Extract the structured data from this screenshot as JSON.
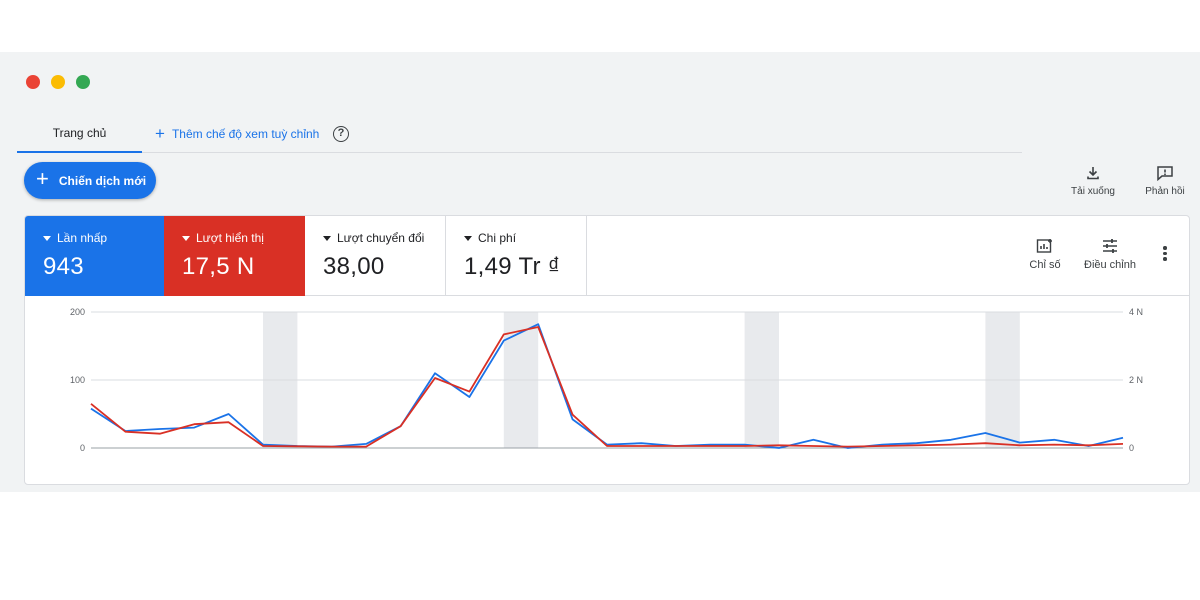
{
  "tabs": {
    "home": "Trang chủ",
    "add_view": "Thêm chế độ xem tuỳ chỉnh",
    "help": "?"
  },
  "new_campaign": "Chiến dịch mới",
  "utilities": {
    "download": "Tải xuống",
    "feedback": "Phản hồi"
  },
  "metrics": [
    {
      "label": "Lần nhấp",
      "value": "943",
      "color": "#1a73e8"
    },
    {
      "label": "Lượt hiển thị",
      "value": "17,5 N",
      "color": "#d93025"
    },
    {
      "label": "Lượt chuyển đổi",
      "value": "38,00"
    },
    {
      "label": "Chi phí",
      "value": "1,49 Tr ₫"
    }
  ],
  "tools": {
    "metrics": "Chỉ số",
    "adjust": "Điều chỉnh"
  },
  "colors": {
    "clicks": "#1a73e8",
    "impressions": "#d93025",
    "weekend_band": "#e8eaed"
  },
  "chart_data": {
    "type": "line",
    "left_axis": {
      "ticks": [
        "200",
        "100",
        "0"
      ],
      "range": [
        0,
        200
      ]
    },
    "right_axis": {
      "ticks": [
        "4 N",
        "2 N",
        "0"
      ],
      "range": [
        0,
        4000
      ]
    },
    "shaded_ranges": [
      [
        5,
        6
      ],
      [
        12,
        13
      ],
      [
        19,
        20
      ],
      [
        26,
        27
      ]
    ],
    "series": [
      {
        "axis": "left",
        "values": [
          58,
          25,
          28,
          30,
          50,
          5,
          3,
          2,
          6,
          32,
          110,
          75,
          158,
          182,
          42,
          5,
          7,
          3,
          5,
          5,
          0,
          12,
          0,
          5,
          7,
          12,
          22,
          8,
          12,
          3,
          15
        ]
      },
      {
        "axis": "right",
        "values": [
          1300,
          480,
          420,
          700,
          760,
          60,
          50,
          40,
          40,
          640,
          2060,
          1660,
          3340,
          3560,
          980,
          60,
          60,
          60,
          60,
          60,
          80,
          60,
          40,
          60,
          80,
          100,
          140,
          80,
          100,
          80,
          120
        ]
      }
    ]
  }
}
